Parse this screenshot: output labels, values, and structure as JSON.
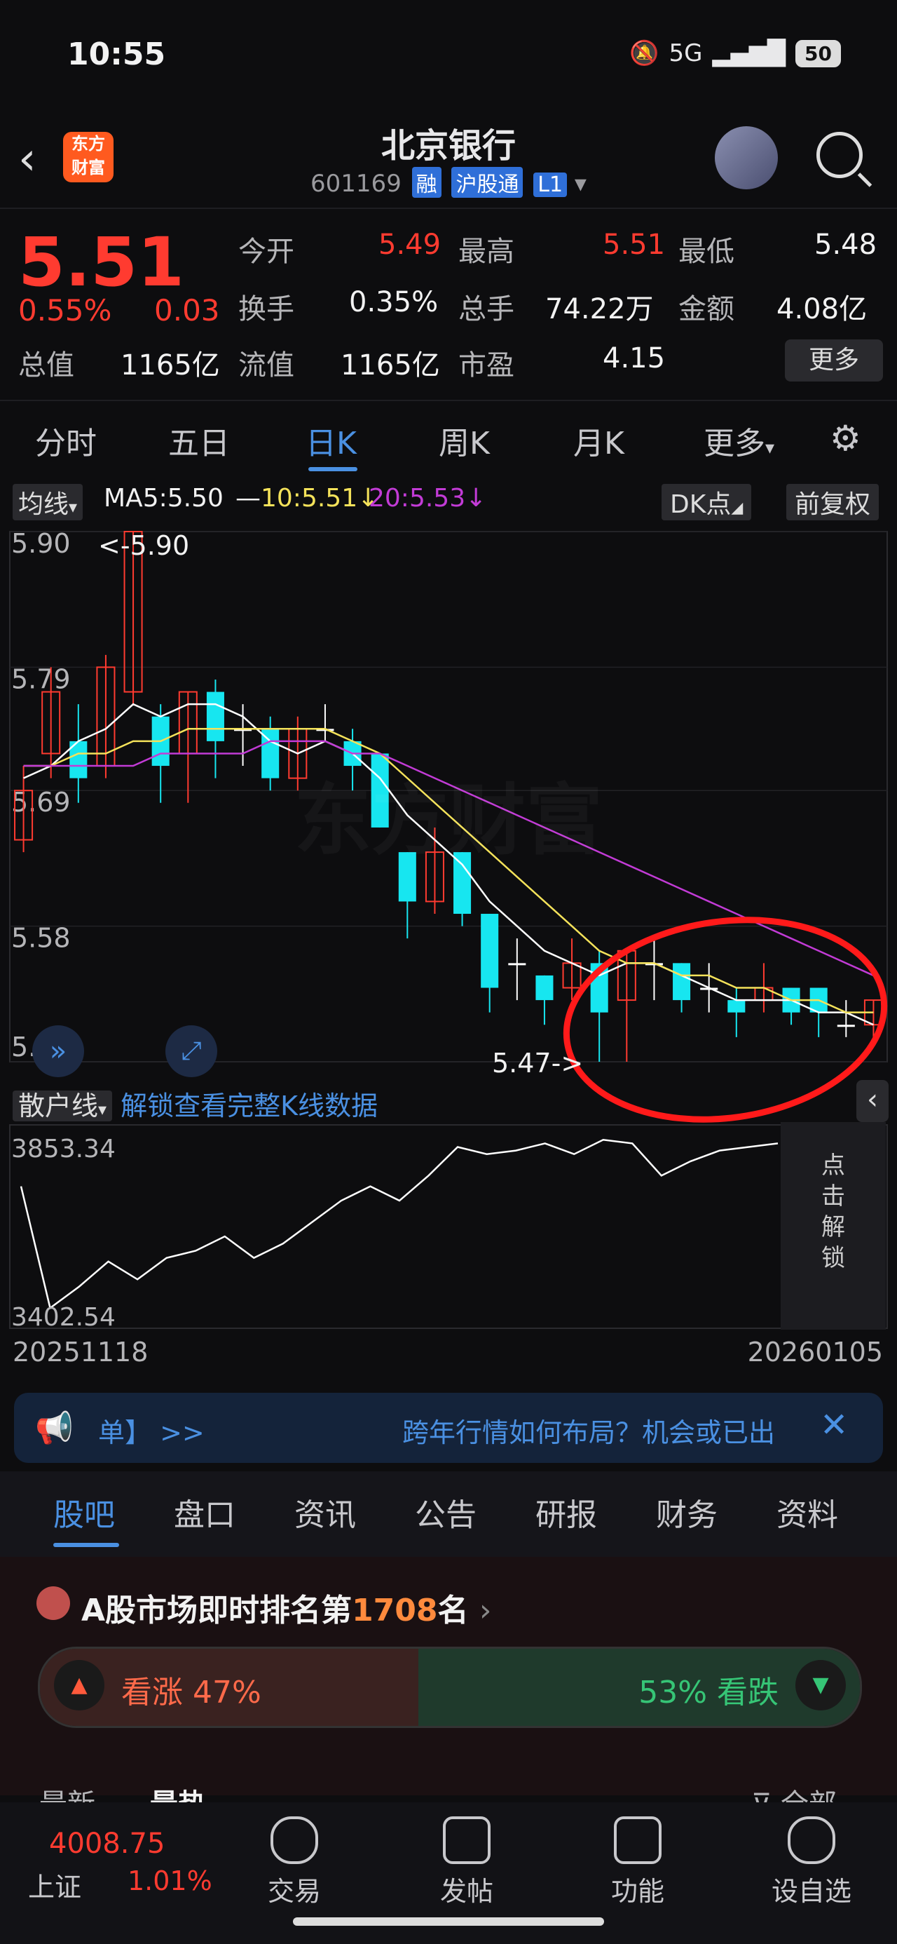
{
  "status": {
    "time": "10:55",
    "network": "5G",
    "battery": "50"
  },
  "header": {
    "title": "北京银行",
    "code": "601169",
    "tags": [
      "融",
      "沪股通",
      "L1"
    ],
    "logo_text": "东方财富"
  },
  "quote": {
    "price": "5.51",
    "pct": "0.55%",
    "change": "0.03",
    "stats": [
      {
        "label": "今开",
        "value": "5.49",
        "color": "red"
      },
      {
        "label": "最高",
        "value": "5.51",
        "color": "red"
      },
      {
        "label": "最低",
        "value": "5.48",
        "color": "white"
      },
      {
        "label": "换手",
        "value": "0.35%",
        "color": "white"
      },
      {
        "label": "总手",
        "value": "74.22万",
        "color": "white"
      },
      {
        "label": "金额",
        "value": "4.08亿",
        "color": "white"
      },
      {
        "label": "总值",
        "value": "1165亿",
        "color": "white"
      },
      {
        "label": "流值",
        "value": "1165亿",
        "color": "white"
      },
      {
        "label": "市盈",
        "value": "4.15",
        "color": "white"
      }
    ],
    "more_label": "更多"
  },
  "chart_tabs": [
    "分时",
    "五日",
    "日K",
    "周K",
    "月K",
    "更多"
  ],
  "ma": {
    "label": "均线",
    "ma5": "MA5:5.50",
    "ma10": "10:5.51",
    "ma20": "20:5.53",
    "dk_label": "DK点",
    "fq_label": "前复权"
  },
  "chart_data": {
    "type": "candlestick",
    "y_ticks": [
      "5.90",
      "5.79",
      "5.69",
      "5.58",
      "5.47"
    ],
    "ylim": [
      5.47,
      5.9
    ],
    "high_label": "<-5.90",
    "low_label": "5.47->",
    "watermark": "东方财富",
    "candles": [
      {
        "o": 5.65,
        "c": 5.69,
        "h": 5.71,
        "l": 5.64
      },
      {
        "o": 5.72,
        "c": 5.77,
        "h": 5.79,
        "l": 5.7
      },
      {
        "o": 5.73,
        "c": 5.7,
        "h": 5.76,
        "l": 5.68
      },
      {
        "o": 5.71,
        "c": 5.79,
        "h": 5.8,
        "l": 5.7
      },
      {
        "o": 5.77,
        "c": 5.9,
        "h": 5.9,
        "l": 5.76
      },
      {
        "o": 5.75,
        "c": 5.71,
        "h": 5.76,
        "l": 5.68
      },
      {
        "o": 5.72,
        "c": 5.77,
        "h": 5.77,
        "l": 5.68
      },
      {
        "o": 5.77,
        "c": 5.73,
        "h": 5.78,
        "l": 5.7
      },
      {
        "o": 5.74,
        "c": 5.74,
        "h": 5.76,
        "l": 5.71
      },
      {
        "o": 5.74,
        "c": 5.7,
        "h": 5.75,
        "l": 5.69
      },
      {
        "o": 5.7,
        "c": 5.74,
        "h": 5.75,
        "l": 5.69
      },
      {
        "o": 5.74,
        "c": 5.74,
        "h": 5.76,
        "l": 5.73
      },
      {
        "o": 5.73,
        "c": 5.71,
        "h": 5.74,
        "l": 5.69
      },
      {
        "o": 5.72,
        "c": 5.66,
        "h": 5.72,
        "l": 5.66
      },
      {
        "o": 5.64,
        "c": 5.6,
        "h": 5.64,
        "l": 5.57
      },
      {
        "o": 5.6,
        "c": 5.64,
        "h": 5.66,
        "l": 5.59
      },
      {
        "o": 5.64,
        "c": 5.59,
        "h": 5.64,
        "l": 5.58
      },
      {
        "o": 5.59,
        "c": 5.53,
        "h": 5.59,
        "l": 5.51
      },
      {
        "o": 5.55,
        "c": 5.55,
        "h": 5.57,
        "l": 5.52
      },
      {
        "o": 5.54,
        "c": 5.52,
        "h": 5.54,
        "l": 5.5
      },
      {
        "o": 5.53,
        "c": 5.55,
        "h": 5.57,
        "l": 5.52
      },
      {
        "o": 5.55,
        "c": 5.51,
        "h": 5.56,
        "l": 5.47
      },
      {
        "o": 5.52,
        "c": 5.56,
        "h": 5.56,
        "l": 5.47
      },
      {
        "o": 5.55,
        "c": 5.55,
        "h": 5.57,
        "l": 5.52
      },
      {
        "o": 5.55,
        "c": 5.52,
        "h": 5.55,
        "l": 5.51
      },
      {
        "o": 5.53,
        "c": 5.53,
        "h": 5.55,
        "l": 5.51
      },
      {
        "o": 5.52,
        "c": 5.51,
        "h": 5.53,
        "l": 5.49
      },
      {
        "o": 5.52,
        "c": 5.53,
        "h": 5.55,
        "l": 5.51
      },
      {
        "o": 5.53,
        "c": 5.51,
        "h": 5.53,
        "l": 5.5
      },
      {
        "o": 5.53,
        "c": 5.51,
        "h": 5.53,
        "l": 5.49
      },
      {
        "o": 5.5,
        "c": 5.5,
        "h": 5.52,
        "l": 5.49
      },
      {
        "o": 5.5,
        "c": 5.52,
        "h": 5.52,
        "l": 5.49
      }
    ],
    "series": [
      {
        "values": [
          5.7,
          5.71,
          5.73,
          5.74,
          5.76,
          5.75,
          5.76,
          5.76,
          5.75,
          5.73,
          5.72,
          5.73,
          5.72,
          5.7,
          5.67,
          5.65,
          5.63,
          5.6,
          5.58,
          5.56,
          5.55,
          5.54,
          5.55,
          5.55,
          5.54,
          5.53,
          5.52,
          5.52,
          5.52,
          5.51,
          5.51,
          5.5
        ],
        "color": "#ffffff"
      },
      {
        "values": [
          5.71,
          5.71,
          5.72,
          5.72,
          5.73,
          5.73,
          5.74,
          5.74,
          5.74,
          5.74,
          5.74,
          5.74,
          5.73,
          5.72,
          5.7,
          5.68,
          5.66,
          5.64,
          5.62,
          5.6,
          5.58,
          5.56,
          5.55,
          5.55,
          5.54,
          5.54,
          5.53,
          5.53,
          5.52,
          5.52,
          5.51,
          5.51
        ],
        "color": "#f4e25a"
      },
      {
        "values": [
          5.71,
          5.71,
          5.71,
          5.71,
          5.71,
          5.72,
          5.72,
          5.72,
          5.72,
          5.73,
          5.73,
          5.73,
          5.72,
          5.72,
          5.71,
          5.7,
          5.69,
          5.68,
          5.67,
          5.66,
          5.65,
          5.64,
          5.63,
          5.62,
          5.61,
          5.6,
          5.59,
          5.58,
          5.57,
          5.56,
          5.55,
          5.54
        ],
        "color": "#c23bd6"
      }
    ]
  },
  "retail": {
    "label": "散户线",
    "unlock_text": "解锁查看完整K线数据",
    "y_top": "3853.34",
    "y_bottom": "3402.54",
    "side_text": "点击解锁",
    "values": [
      3760,
      3420,
      3480,
      3550,
      3500,
      3560,
      3580,
      3620,
      3560,
      3600,
      3660,
      3720,
      3760,
      3720,
      3790,
      3870,
      3850,
      3860,
      3880,
      3850,
      3890,
      3880,
      3790,
      3830,
      3860,
      3870,
      3880
    ]
  },
  "dates": {
    "start": "20251118",
    "end": "20260105"
  },
  "news": {
    "prefix": "单】 >>",
    "text": "跨年行情如何布局？机会或已出"
  },
  "bottom_tabs": [
    "股吧",
    "盘口",
    "资讯",
    "公告",
    "研报",
    "财务",
    "资料"
  ],
  "rank": {
    "text": "A股市场即时排名第",
    "number": "1708",
    "suffix": "名"
  },
  "vote": {
    "up": "看涨 47%",
    "down": "53% 看跌"
  },
  "feed": {
    "left1": "最新",
    "left2": "最热",
    "right": "全部"
  },
  "nav": {
    "index_value": "4008.75",
    "index_name": "上证",
    "index_pct": "1.01%",
    "items": [
      "交易",
      "发帖",
      "功能",
      "设自选"
    ]
  }
}
